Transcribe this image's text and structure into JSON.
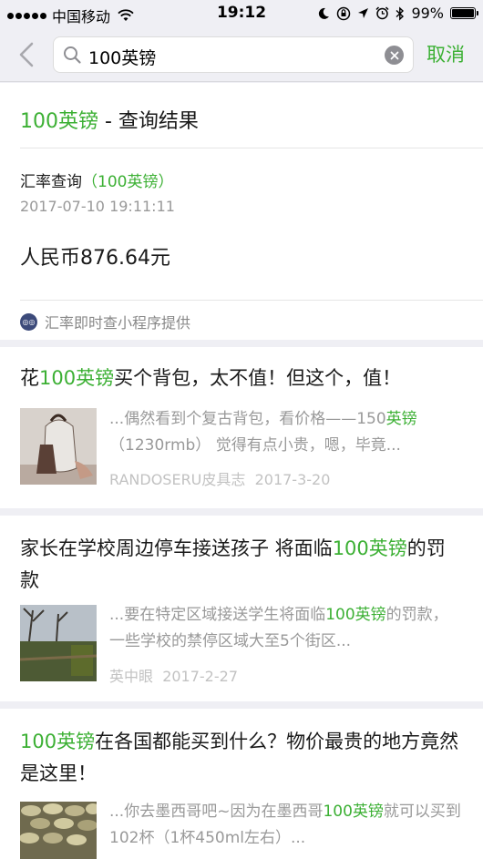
{
  "status_bar": {
    "carrier": "中国移动",
    "time": "19:12",
    "battery_percent": "99%",
    "battery_level": 0.99
  },
  "search": {
    "query": "100英镑",
    "cancel_label": "取消"
  },
  "result_card": {
    "title_keyword": "100英镑",
    "title_suffix": " - 查询结果",
    "rate_label": "汇率查询",
    "rate_keyword": "（100英镑）",
    "timestamp": "2017-07-10 19:11:11",
    "value": "人民币876.64元",
    "provider": "汇率即时查小程序提供"
  },
  "articles": [
    {
      "title_parts": [
        "花",
        "100英镑",
        "买个背包，太不值！但这个，值！"
      ],
      "snippet_parts": [
        "...偶然看到个复古背包，看价格——150",
        "英镑",
        "（1230rmb） 觉得有点小贵，嗯，毕竟..."
      ],
      "source": "RANDOSERU皮具志",
      "date": "2017-3-20"
    },
    {
      "title_parts": [
        "家长在学校周边停车接送孩子 将面临",
        "100英镑",
        "的罚款"
      ],
      "snippet_parts": [
        "...要在特定区域接送学生将面临",
        "100英镑",
        "的罚款，一些学校的禁停区域大至5个街区..."
      ],
      "source": "英中眼",
      "date": "2017-2-27"
    },
    {
      "title_parts": [
        "",
        "100英镑",
        "在各国都能买到什么？物价最贵的地方竟然是这里！"
      ],
      "snippet_parts": [
        "...你去墨西哥吧~因为在墨西哥",
        "100英镑",
        "就可以买到102杯（1杯450ml左右）..."
      ],
      "source": "",
      "date": ""
    }
  ],
  "colors": {
    "accent": "#3cb034",
    "background": "#efeff4"
  }
}
